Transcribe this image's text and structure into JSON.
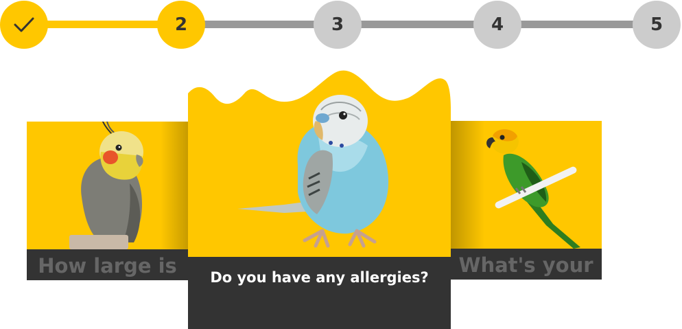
{
  "stepper": {
    "steps": [
      {
        "label": "",
        "state": "done",
        "icon": "check-icon"
      },
      {
        "label": "2",
        "state": "active"
      },
      {
        "label": "3",
        "state": "todo"
      },
      {
        "label": "4",
        "state": "todo"
      },
      {
        "label": "5",
        "state": "todo"
      }
    ]
  },
  "cards": {
    "left": {
      "caption": "How large is",
      "image": "cockatiel"
    },
    "center": {
      "caption": "Do you have any allergies?",
      "image": "budgerigar"
    },
    "right": {
      "caption": "What's your",
      "image": "sun-conure"
    }
  },
  "colors": {
    "accent": "#ffc700",
    "dark": "#333333",
    "inactive_step": "#cccccc",
    "track_inactive": "#999999",
    "side_caption_text": "#666666"
  }
}
